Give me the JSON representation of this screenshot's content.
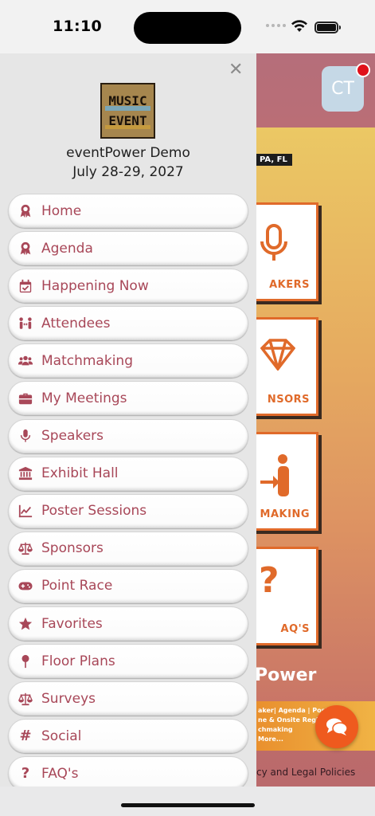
{
  "status_bar": {
    "time": "11:10"
  },
  "background": {
    "avatar_initials": "CT",
    "date_tag": "PA, FL",
    "tiles": [
      {
        "label": "AKERS",
        "icon": "microphone-icon"
      },
      {
        "label": "NSORS",
        "icon": "diamond-icon"
      },
      {
        "label": "MAKING",
        "icon": "person-arrow-icon"
      },
      {
        "label": "AQ'S",
        "icon": "question-icon"
      }
    ],
    "brand_text": "Power",
    "banner_lines": [
      "aker| Agenda | Poste",
      "ne & Onsite Registr",
      "chmaking",
      "More..."
    ],
    "policy_text": "cy and Legal Policies"
  },
  "drawer": {
    "logo_text": [
      "MUSIC",
      "EVENT"
    ],
    "event_name": "eventPower Demo",
    "event_date": "July 28-29, 2027",
    "items": [
      {
        "label": "Home",
        "icon": "award-icon"
      },
      {
        "label": "Agenda",
        "icon": "award-icon"
      },
      {
        "label": "Happening Now",
        "icon": "calendar-check-icon"
      },
      {
        "label": "Attendees",
        "icon": "people-arrows-icon"
      },
      {
        "label": "Matchmaking",
        "icon": "users-icon"
      },
      {
        "label": "My Meetings",
        "icon": "briefcase-icon"
      },
      {
        "label": "Speakers",
        "icon": "microphone-icon"
      },
      {
        "label": "Exhibit Hall",
        "icon": "landmark-icon"
      },
      {
        "label": "Poster Sessions",
        "icon": "line-chart-icon"
      },
      {
        "label": "Sponsors",
        "icon": "scale-icon"
      },
      {
        "label": "Point Race",
        "icon": "gamepad-icon"
      },
      {
        "label": "Favorites",
        "icon": "star-icon"
      },
      {
        "label": "Floor Plans",
        "icon": "map-pin-icon"
      },
      {
        "label": "Surveys",
        "icon": "scale-icon"
      },
      {
        "label": "Social",
        "icon": "hashtag-icon"
      },
      {
        "label": "FAQ's",
        "icon": "question-icon"
      }
    ]
  },
  "colors": {
    "accent": "#a84758",
    "orange": "#ef5a1e"
  }
}
